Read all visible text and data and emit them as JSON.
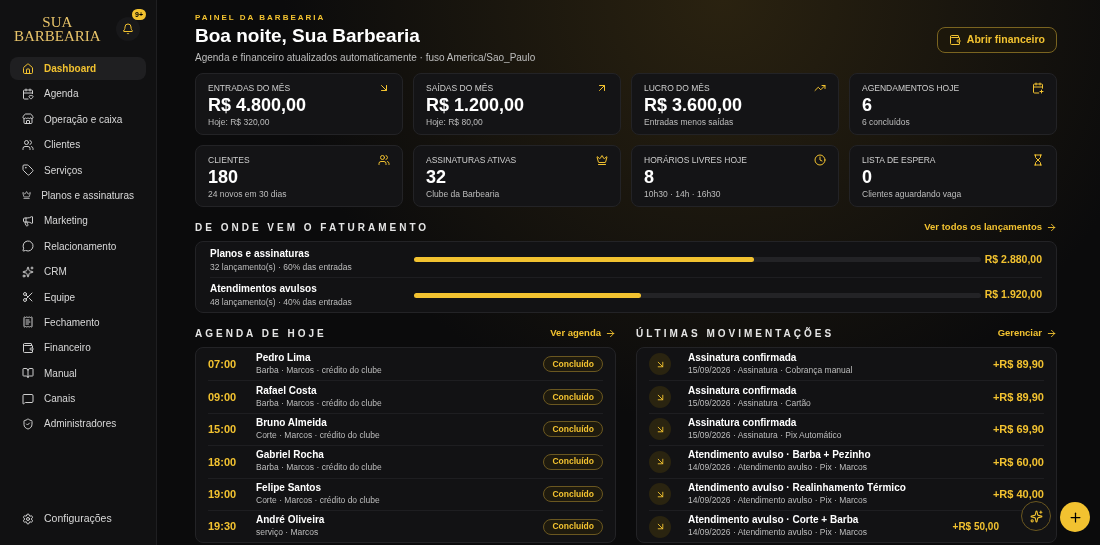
{
  "sidebar": {
    "logo": [
      "SUA",
      "BARBEARIA"
    ],
    "notification_badge": "9+",
    "items": [
      {
        "label": "Dashboard",
        "selected": true
      },
      {
        "label": "Agenda",
        "selected": false
      },
      {
        "label": "Operação e caixa",
        "selected": false
      },
      {
        "label": "Clientes",
        "selected": false
      },
      {
        "label": "Serviços",
        "selected": false
      },
      {
        "label": "Planos e assinaturas",
        "selected": false
      },
      {
        "label": "Marketing",
        "selected": false
      },
      {
        "label": "Relacionamento",
        "selected": false
      },
      {
        "label": "CRM",
        "selected": false
      },
      {
        "label": "Equipe",
        "selected": false
      },
      {
        "label": "Fechamento",
        "selected": false
      },
      {
        "label": "Financeiro",
        "selected": false
      },
      {
        "label": "Manual",
        "selected": false
      },
      {
        "label": "Canais",
        "selected": false
      },
      {
        "label": "Administradores",
        "selected": false
      }
    ],
    "settings": "Configurações"
  },
  "header": {
    "eyebrow": "PAINEL DA BARBEARIA",
    "title": "Boa noite, Sua Barbearia",
    "subtitle": "Agenda e financeiro atualizados automaticamente · fuso America/Sao_Paulo",
    "button": "Abrir financeiro"
  },
  "stats": [
    {
      "label": "ENTRADAS DO MÊS",
      "value": "R$ 4.800,00",
      "note": "Hoje: R$ 320,00"
    },
    {
      "label": "SAÍDAS DO MÊS",
      "value": "R$ 1.200,00",
      "note": "Hoje: R$ 80,00"
    },
    {
      "label": "LUCRO DO MÊS",
      "value": "R$ 3.600,00",
      "note": "Entradas menos saídas"
    },
    {
      "label": "AGENDAMENTOS HOJE",
      "value": "6",
      "note": "6 concluídos"
    },
    {
      "label": "CLIENTES",
      "value": "180",
      "note": "24 novos em 30 dias"
    },
    {
      "label": "ASSINATURAS ATIVAS",
      "value": "32",
      "note": "Clube da Barbearia"
    },
    {
      "label": "HORÁRIOS LIVRES HOJE",
      "value": "8",
      "note": "10h30 · 14h · 16h30"
    },
    {
      "label": "LISTA DE ESPERA",
      "value": "0",
      "note": "Clientes aguardando vaga"
    }
  ],
  "revenue": {
    "title": "DE ONDE VEM O FATURAMENTO",
    "link": "Ver todos os lançamentos",
    "rows": [
      {
        "name": "Planos e assinaturas",
        "detail": "32 lançamento(s) · 60% das entradas",
        "level": 0.6,
        "amount": "R$ 2.880,00"
      },
      {
        "name": "Atendimentos avulsos",
        "detail": "48 lançamento(s) · 40% das entradas",
        "level": 0.4,
        "amount": "R$ 1.920,00"
      }
    ]
  },
  "agenda": {
    "title": "AGENDA DE HOJE",
    "link": "Ver agenda",
    "rows": [
      {
        "time": "07:00",
        "client": "Pedro Lima",
        "detail": "Barba · Marcos · crédito do clube",
        "status": "Concluído"
      },
      {
        "time": "09:00",
        "client": "Rafael Costa",
        "detail": "Barba · Marcos · crédito do clube",
        "status": "Concluído"
      },
      {
        "time": "15:00",
        "client": "Bruno Almeida",
        "detail": "Corte · Marcos · crédito do clube",
        "status": "Concluído"
      },
      {
        "time": "18:00",
        "client": "Gabriel Rocha",
        "detail": "Barba · Marcos · crédito do clube",
        "status": "Concluído"
      },
      {
        "time": "19:00",
        "client": "Felipe Santos",
        "detail": "Corte · Marcos · crédito do clube",
        "status": "Concluído"
      },
      {
        "time": "19:30",
        "client": "André Oliveira",
        "detail": "serviço · Marcos",
        "status": "Concluído"
      }
    ]
  },
  "movements": {
    "title": "ÚLTIMAS MOVIMENTAÇÕES",
    "link": "Gerenciar",
    "rows": [
      {
        "title": "Assinatura confirmada",
        "detail": "15/09/2026 · Assinatura · Cobrança manual",
        "amount": "+R$ 89,90"
      },
      {
        "title": "Assinatura confirmada",
        "detail": "15/09/2026 · Assinatura · Cartão",
        "amount": "+R$ 89,90"
      },
      {
        "title": "Assinatura confirmada",
        "detail": "15/09/2026 · Assinatura · Pix Automático",
        "amount": "+R$ 69,90"
      },
      {
        "title": "Atendimento avulso · Barba + Pezinho",
        "detail": "14/09/2026 · Atendimento avulso · Pix · Marcos",
        "amount": "+R$ 60,00"
      },
      {
        "title": "Atendimento avulso · Realinhamento Térmico",
        "detail": "14/09/2026 · Atendimento avulso · Pix · Marcos",
        "amount": "+R$ 40,00"
      },
      {
        "title": "Atendimento avulso · Corte + Barba",
        "detail": "14/09/2026 · Atendimento avulso · Pix · Marcos",
        "amount": "+R$ 50,00"
      }
    ]
  }
}
